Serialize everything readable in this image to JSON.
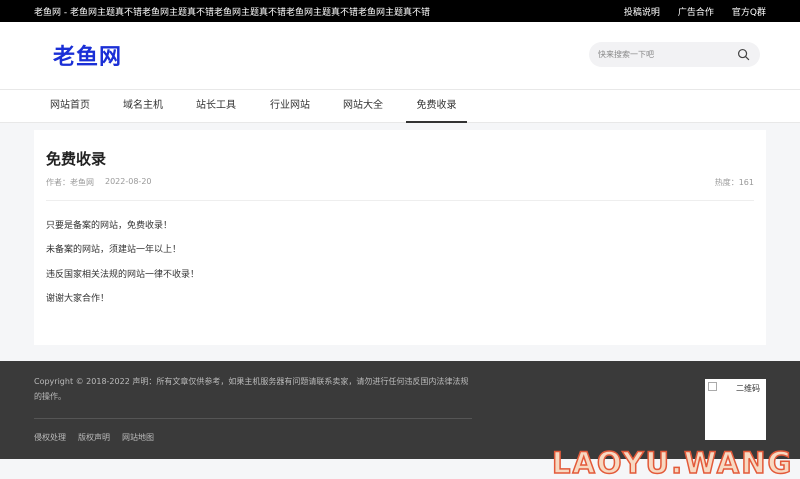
{
  "topbar": {
    "tagline": "老鱼网 - 老鱼网主题真不错老鱼网主题真不错老鱼网主题真不错老鱼网主题真不错老鱼网主题真不错",
    "links": [
      "投稿说明",
      "广告合作",
      "官方Q群"
    ]
  },
  "header": {
    "logo": "老鱼网",
    "search_placeholder": "快来搜索一下吧",
    "search_icon": "search-icon"
  },
  "nav": {
    "items": [
      "网站首页",
      "域名主机",
      "站长工具",
      "行业网站",
      "网站大全",
      "免费收录"
    ],
    "active": "免费收录"
  },
  "article": {
    "title": "免费收录",
    "author": "作者：老鱼网",
    "date": "2022-08-20",
    "hot": "热度：161",
    "paragraphs": [
      "只要是备案的网站，免费收录！",
      "未备案的网站，须建站一年以上！",
      "违反国家相关法规的网站一律不收录！",
      "谢谢大家合作！"
    ]
  },
  "footer": {
    "copyright": "Copyright © 2018-2022 声明：所有文章仅供参考，如果主机服务器有问题请联系卖家，请勿进行任何违反国内法律法规的操作。",
    "links": [
      "侵权处理",
      "版权声明",
      "网站地图"
    ],
    "qr_alt": "二维码"
  },
  "watermark": "LAOYU.WANG"
}
